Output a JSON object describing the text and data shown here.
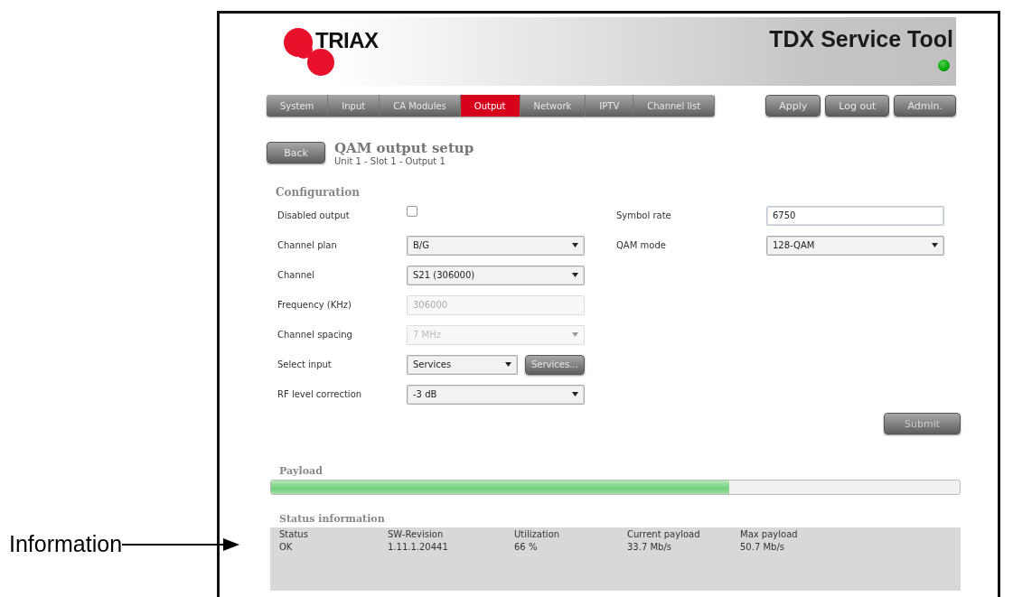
{
  "header": {
    "logo": "TRIAX",
    "title": "TDX Service Tool",
    "connected": true
  },
  "nav_tabs": [
    {
      "label": "System",
      "selected": false
    },
    {
      "label": "Input",
      "selected": false
    },
    {
      "label": "CA Modules",
      "selected": false
    },
    {
      "label": "Output",
      "selected": true
    },
    {
      "label": "Network",
      "selected": false
    },
    {
      "label": "IPTV",
      "selected": false
    },
    {
      "label": "Channel list",
      "selected": false
    }
  ],
  "actions": [
    "Apply",
    "Log out",
    "Admin."
  ],
  "page": {
    "back": "Back",
    "title": "QAM  output setup",
    "subtitle": "Unit 1 - Slot 1 - Output 1"
  },
  "configuration": {
    "heading": "Configuration",
    "left": [
      {
        "kind": "checkbox",
        "label": "Disabled output",
        "checked": false,
        "disabled": false
      },
      {
        "kind": "select",
        "label": "Channel plan",
        "value": "B/G",
        "disabled": false
      },
      {
        "kind": "select",
        "label": "Channel",
        "value": "S21 (306000)",
        "disabled": false
      },
      {
        "kind": "text",
        "label": "Frequency (KHz)",
        "value": "306000",
        "disabled": true
      },
      {
        "kind": "select",
        "label": "Channel spacing",
        "value": "7 MHz",
        "disabled": true
      },
      {
        "kind": "select-button",
        "label": "Select input",
        "value": "Services",
        "button": "Services...",
        "disabled": false
      },
      {
        "kind": "select",
        "label": "RF level correction",
        "value": "-3 dB",
        "disabled": false
      }
    ],
    "right": [
      {
        "kind": "text",
        "label": "Symbol rate",
        "value": "6750",
        "disabled": false
      },
      {
        "kind": "select",
        "label": "QAM mode",
        "value": "128-QAM",
        "disabled": false
      }
    ],
    "submit": "Submit"
  },
  "payload": {
    "heading": "Payload",
    "level": 0.666
  },
  "status_information": {
    "heading": "Status information",
    "columns": [
      "Status",
      "SW-Revision",
      "Utilization",
      "Current payload",
      "Max payload"
    ],
    "row": [
      "OK",
      "1.11.1.20441",
      "66 %",
      "33.7 Mb/s",
      "50.7 Mb/s"
    ]
  },
  "callout": {
    "label": "Information"
  }
}
